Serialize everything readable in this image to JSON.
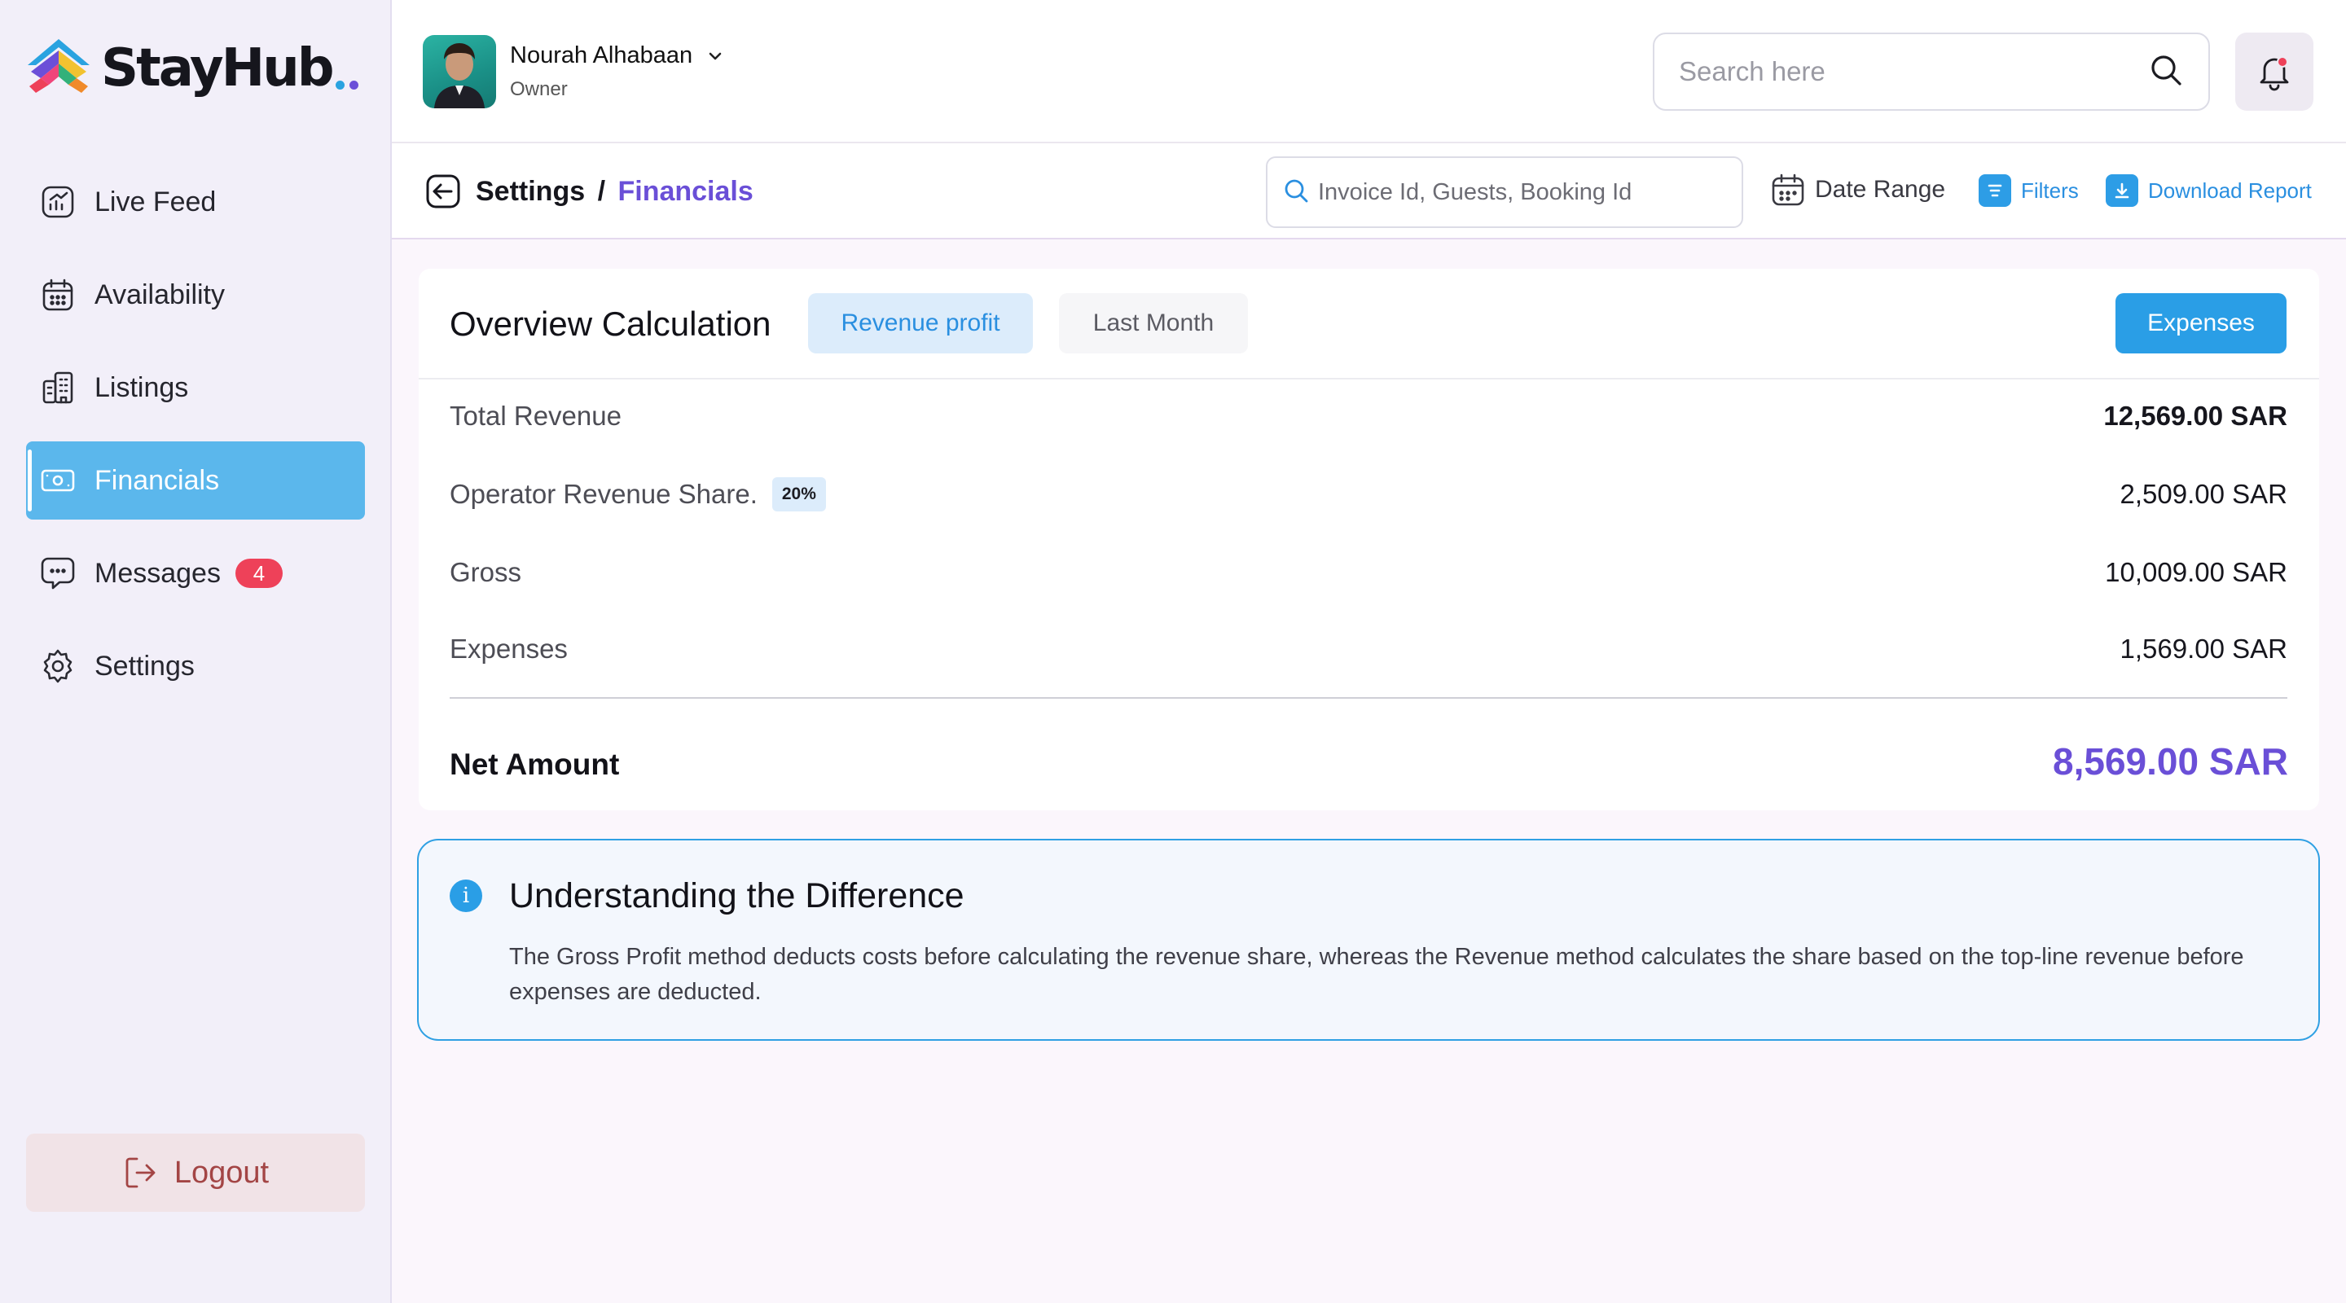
{
  "app": {
    "logo_text": "StayHub",
    "brand_color": "#6a4fd7",
    "accent_color": "#2a9ee6"
  },
  "sidebar": {
    "items": [
      {
        "label": "Live Feed",
        "icon": "chart-icon",
        "active": false
      },
      {
        "label": "Availability",
        "icon": "calendar-icon",
        "active": false
      },
      {
        "label": "Listings",
        "icon": "building-icon",
        "active": false
      },
      {
        "label": "Financials",
        "icon": "money-icon",
        "active": true
      },
      {
        "label": "Messages",
        "icon": "chat-icon",
        "active": false,
        "badge": "4"
      },
      {
        "label": "Settings",
        "icon": "gear-icon",
        "active": false
      }
    ],
    "logout_label": "Logout"
  },
  "header": {
    "user_name": "Nourah Alhabaan",
    "user_role": "Owner",
    "search_placeholder": "Search here"
  },
  "subheader": {
    "breadcrumb_parent": "Settings",
    "breadcrumb_separator": "/",
    "breadcrumb_current": "Financials",
    "search_placeholder": "Invoice Id, Guests, Booking Id",
    "date_range_label": "Date Range",
    "filters_label": "Filters",
    "download_label": "Download Report"
  },
  "overview": {
    "title": "Overview Calculation",
    "chip_revenue": "Revenue profit",
    "chip_period": "Last Month",
    "expenses_button": "Expenses",
    "rows": [
      {
        "label": "Total Revenue",
        "value": "12,569.00 SAR"
      },
      {
        "label": "Operator Revenue Share.",
        "value": "2,509.00 SAR",
        "badge": "20%"
      },
      {
        "label": "Gross",
        "value": "10,009.00 SAR"
      },
      {
        "label": "Expenses",
        "value": "1,569.00 SAR"
      }
    ],
    "net_label": "Net Amount",
    "net_value": "8,569.00 SAR"
  },
  "info": {
    "title": "Understanding the Difference",
    "text": "The Gross Profit method deducts costs before calculating the revenue share, whereas the Revenue method calculates the share based on the top-line revenue before expenses are deducted."
  }
}
